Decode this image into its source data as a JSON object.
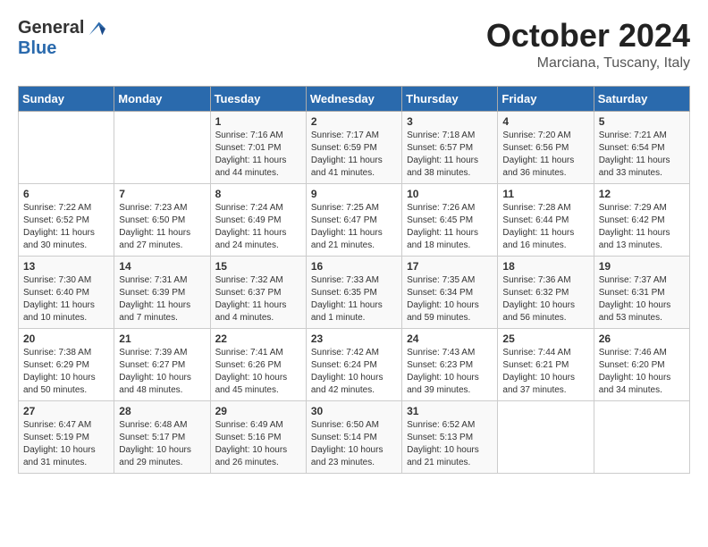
{
  "header": {
    "logo_general": "General",
    "logo_blue": "Blue",
    "month_title": "October 2024",
    "location": "Marciana, Tuscany, Italy"
  },
  "days_of_week": [
    "Sunday",
    "Monday",
    "Tuesday",
    "Wednesday",
    "Thursday",
    "Friday",
    "Saturday"
  ],
  "weeks": [
    [
      {
        "day": "",
        "info": ""
      },
      {
        "day": "",
        "info": ""
      },
      {
        "day": "1",
        "info": "Sunrise: 7:16 AM\nSunset: 7:01 PM\nDaylight: 11 hours and 44 minutes."
      },
      {
        "day": "2",
        "info": "Sunrise: 7:17 AM\nSunset: 6:59 PM\nDaylight: 11 hours and 41 minutes."
      },
      {
        "day": "3",
        "info": "Sunrise: 7:18 AM\nSunset: 6:57 PM\nDaylight: 11 hours and 38 minutes."
      },
      {
        "day": "4",
        "info": "Sunrise: 7:20 AM\nSunset: 6:56 PM\nDaylight: 11 hours and 36 minutes."
      },
      {
        "day": "5",
        "info": "Sunrise: 7:21 AM\nSunset: 6:54 PM\nDaylight: 11 hours and 33 minutes."
      }
    ],
    [
      {
        "day": "6",
        "info": "Sunrise: 7:22 AM\nSunset: 6:52 PM\nDaylight: 11 hours and 30 minutes."
      },
      {
        "day": "7",
        "info": "Sunrise: 7:23 AM\nSunset: 6:50 PM\nDaylight: 11 hours and 27 minutes."
      },
      {
        "day": "8",
        "info": "Sunrise: 7:24 AM\nSunset: 6:49 PM\nDaylight: 11 hours and 24 minutes."
      },
      {
        "day": "9",
        "info": "Sunrise: 7:25 AM\nSunset: 6:47 PM\nDaylight: 11 hours and 21 minutes."
      },
      {
        "day": "10",
        "info": "Sunrise: 7:26 AM\nSunset: 6:45 PM\nDaylight: 11 hours and 18 minutes."
      },
      {
        "day": "11",
        "info": "Sunrise: 7:28 AM\nSunset: 6:44 PM\nDaylight: 11 hours and 16 minutes."
      },
      {
        "day": "12",
        "info": "Sunrise: 7:29 AM\nSunset: 6:42 PM\nDaylight: 11 hours and 13 minutes."
      }
    ],
    [
      {
        "day": "13",
        "info": "Sunrise: 7:30 AM\nSunset: 6:40 PM\nDaylight: 11 hours and 10 minutes."
      },
      {
        "day": "14",
        "info": "Sunrise: 7:31 AM\nSunset: 6:39 PM\nDaylight: 11 hours and 7 minutes."
      },
      {
        "day": "15",
        "info": "Sunrise: 7:32 AM\nSunset: 6:37 PM\nDaylight: 11 hours and 4 minutes."
      },
      {
        "day": "16",
        "info": "Sunrise: 7:33 AM\nSunset: 6:35 PM\nDaylight: 11 hours and 1 minute."
      },
      {
        "day": "17",
        "info": "Sunrise: 7:35 AM\nSunset: 6:34 PM\nDaylight: 10 hours and 59 minutes."
      },
      {
        "day": "18",
        "info": "Sunrise: 7:36 AM\nSunset: 6:32 PM\nDaylight: 10 hours and 56 minutes."
      },
      {
        "day": "19",
        "info": "Sunrise: 7:37 AM\nSunset: 6:31 PM\nDaylight: 10 hours and 53 minutes."
      }
    ],
    [
      {
        "day": "20",
        "info": "Sunrise: 7:38 AM\nSunset: 6:29 PM\nDaylight: 10 hours and 50 minutes."
      },
      {
        "day": "21",
        "info": "Sunrise: 7:39 AM\nSunset: 6:27 PM\nDaylight: 10 hours and 48 minutes."
      },
      {
        "day": "22",
        "info": "Sunrise: 7:41 AM\nSunset: 6:26 PM\nDaylight: 10 hours and 45 minutes."
      },
      {
        "day": "23",
        "info": "Sunrise: 7:42 AM\nSunset: 6:24 PM\nDaylight: 10 hours and 42 minutes."
      },
      {
        "day": "24",
        "info": "Sunrise: 7:43 AM\nSunset: 6:23 PM\nDaylight: 10 hours and 39 minutes."
      },
      {
        "day": "25",
        "info": "Sunrise: 7:44 AM\nSunset: 6:21 PM\nDaylight: 10 hours and 37 minutes."
      },
      {
        "day": "26",
        "info": "Sunrise: 7:46 AM\nSunset: 6:20 PM\nDaylight: 10 hours and 34 minutes."
      }
    ],
    [
      {
        "day": "27",
        "info": "Sunrise: 6:47 AM\nSunset: 5:19 PM\nDaylight: 10 hours and 31 minutes."
      },
      {
        "day": "28",
        "info": "Sunrise: 6:48 AM\nSunset: 5:17 PM\nDaylight: 10 hours and 29 minutes."
      },
      {
        "day": "29",
        "info": "Sunrise: 6:49 AM\nSunset: 5:16 PM\nDaylight: 10 hours and 26 minutes."
      },
      {
        "day": "30",
        "info": "Sunrise: 6:50 AM\nSunset: 5:14 PM\nDaylight: 10 hours and 23 minutes."
      },
      {
        "day": "31",
        "info": "Sunrise: 6:52 AM\nSunset: 5:13 PM\nDaylight: 10 hours and 21 minutes."
      },
      {
        "day": "",
        "info": ""
      },
      {
        "day": "",
        "info": ""
      }
    ]
  ]
}
